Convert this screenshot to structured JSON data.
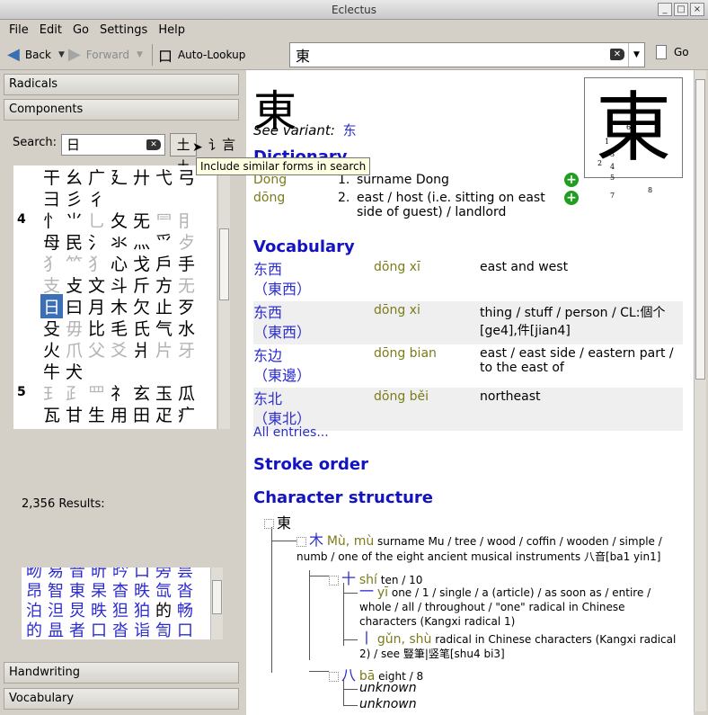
{
  "window": {
    "title": "Eclectus"
  },
  "menu": [
    "File",
    "Edit",
    "Go",
    "Settings",
    "Help"
  ],
  "toolbar": {
    "back": "Back",
    "forward": "Forward",
    "autolookup": "Auto-Lookup",
    "lookup_value": "東",
    "go": "Go"
  },
  "left": {
    "radicals": "Radicals",
    "components": "Components",
    "search_label": "Search:",
    "search_value": "日",
    "similar_btn_glyph": "⼟⼟",
    "variant_btn_glyph": "讠言",
    "tooltip": "Include similar forms in search",
    "component_rows": [
      {
        "num": "",
        "chars": [
          "干",
          "幺",
          "广",
          "廴",
          "廾",
          "弋",
          "弓"
        ],
        "dim": []
      },
      {
        "num": "",
        "chars": [
          "彐",
          "彡",
          "彳"
        ],
        "dim": []
      },
      {
        "num": "4",
        "chars": [
          "忄",
          "⺌",
          "乚",
          "夂",
          "旡",
          "⺜",
          "⺝"
        ],
        "dim": [
          2,
          5,
          6
        ]
      },
      {
        "num": "",
        "chars": [
          "母",
          "民",
          "氵",
          "氺",
          "灬",
          "爫",
          "歺"
        ],
        "dim": [
          6
        ]
      },
      {
        "num": "",
        "chars": [
          "⺨",
          "⺮",
          "犭",
          "心",
          "戈",
          "戶",
          "手"
        ],
        "dim": [
          0,
          1,
          2
        ]
      },
      {
        "num": "",
        "chars": [
          "支",
          "攴",
          "文",
          "斗",
          "斤",
          "方",
          "无"
        ],
        "dim": [
          0,
          6
        ]
      },
      {
        "num": "",
        "chars": [
          "日",
          "曰",
          "月",
          "木",
          "欠",
          "止",
          "歹"
        ],
        "dim": [],
        "sel": 0
      },
      {
        "num": "",
        "chars": [
          "殳",
          "毋",
          "比",
          "毛",
          "氏",
          "气",
          "水"
        ],
        "dim": [
          1
        ]
      },
      {
        "num": "",
        "chars": [
          "火",
          "爪",
          "父",
          "爻",
          "爿",
          "片",
          "牙"
        ],
        "dim": [
          1,
          2,
          3,
          5,
          6
        ]
      },
      {
        "num": "",
        "chars": [
          "牛",
          "犬"
        ],
        "dim": []
      },
      {
        "num": "5",
        "chars": [
          "⺩",
          "⺪",
          "罒",
          "礻",
          "玄",
          "玉",
          "瓜"
        ],
        "dim": [
          0,
          1,
          2
        ]
      },
      {
        "num": "",
        "chars": [
          "瓦",
          "甘",
          "生",
          "用",
          "田",
          "疋",
          "疒"
        ],
        "dim": []
      }
    ],
    "results": "2,356 Results:",
    "result_rows": [
      [
        "旳",
        "易",
        "昔",
        "昕",
        "昽",
        "日",
        "昜",
        "昙"
      ],
      [
        "昒",
        "易",
        "昔",
        "昕",
        "昑",
        "口",
        "旁",
        "昙"
      ],
      [
        "昂",
        "智",
        "東",
        "杲",
        "杳",
        "昳",
        "氙",
        "沓"
      ],
      [
        "泊",
        "泹",
        "炅",
        "昳",
        "狚",
        "狛",
        "的",
        "畅"
      ],
      [
        "的",
        "昷",
        "者",
        "口",
        "沓",
        "诣",
        "訇",
        "口"
      ]
    ],
    "handwriting": "Handwriting",
    "vocabulary": "Vocabulary"
  },
  "entry": {
    "headword": "東",
    "see_variant_label": "See variant:",
    "see_variant_char": "东",
    "dictionary_heading": "Dictionary",
    "dictionary": [
      {
        "reading": "Dōng",
        "num": "1.",
        "def": "surname Dong"
      },
      {
        "reading": "dōng",
        "num": "2.",
        "def": "east / host (i.e. sitting on east side of guest) / landlord"
      }
    ],
    "vocabulary_heading": "Vocabulary",
    "vocabulary": [
      {
        "simp": "东西",
        "trad": "（東西）",
        "pinyin": "dōng xī",
        "def": "east and west"
      },
      {
        "simp": "东西",
        "trad": "（東西）",
        "pinyin": "dōng xi",
        "def": "thing / stuff / person / CL:個个[ge4],件[jian4]"
      },
      {
        "simp": "东边",
        "trad": "（東邊）",
        "pinyin": "dōng bian",
        "def": "east / east side / eastern part / to the east of"
      },
      {
        "simp": "东北",
        "trad": "（東北）",
        "pinyin": "dōng běi",
        "def": "northeast"
      }
    ],
    "all_entries": "All entries...",
    "stroke_heading": "Stroke order",
    "structure_heading": "Character structure",
    "stroke_numbers": [
      "1",
      "2",
      "3",
      "4",
      "5",
      "6",
      "7",
      "8"
    ],
    "structure": {
      "root": "東",
      "n1": {
        "char": "木",
        "pinyin": "Mù, mù",
        "def": "surname Mu / tree / wood / coffin / wooden / simple / numb / one of the eight ancient musical instruments 八音[ba1 yin1]"
      },
      "n2": {
        "char": "十",
        "pinyin": "shí",
        "def": "ten / 10"
      },
      "n3": {
        "char": "一",
        "pinyin": "yī",
        "def": "one / 1 / single / a (article) / as soon as / entire / whole / all / throughout / \"one\" radical in Chinese characters (Kangxi radical 1)"
      },
      "n4": {
        "char": "丨",
        "pinyin": "gǔn, shù",
        "def": "radical in Chinese characters (Kangxi radical 2) / see 豎筆|竖笔[shu4 bi3]"
      },
      "n5": {
        "char": "八",
        "pinyin": "bā",
        "def": "eight / 8"
      },
      "unknown": "unknown"
    }
  }
}
